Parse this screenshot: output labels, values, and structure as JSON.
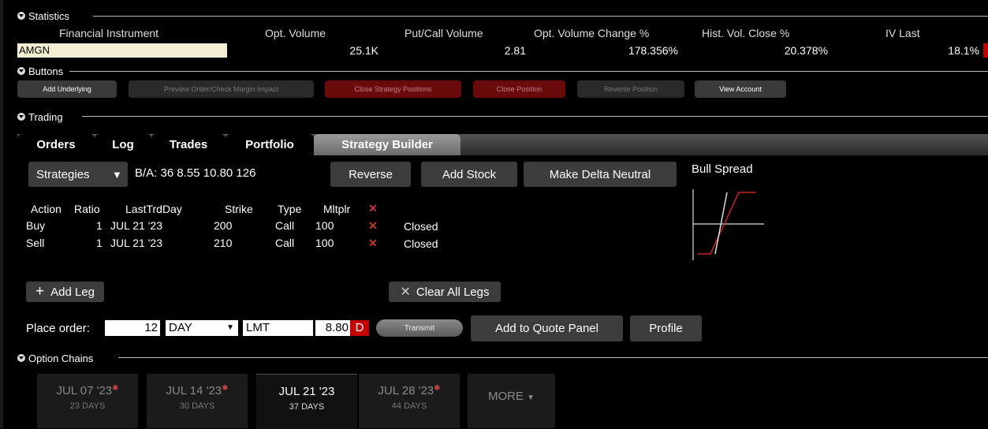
{
  "sections": {
    "statistics": "Statistics",
    "buttons": "Buttons",
    "trading": "Trading",
    "option_chains": "Option Chains"
  },
  "stats": {
    "headers": [
      "Financial Instrument",
      "Opt. Volume",
      "Put/Call Volume",
      "Opt. Volume Change %",
      "Hist. Vol. Close %",
      "IV Last"
    ],
    "instrument": "AMGN",
    "opt_volume": "25.1K",
    "put_call_volume": "2.81",
    "opt_volume_change": "178.356%",
    "hist_vol_close": "20.378%",
    "iv_last": "18.1%"
  },
  "buttons": {
    "add_underlying": "Add Underlying",
    "preview_order": "Preview Order/Check Margin Impact",
    "close_strategy": "Close Strategy Positions",
    "close_position": "Close Position",
    "reverse_position": "Reverse Position",
    "view_account": "View Account"
  },
  "tabs": [
    "Orders",
    "Log",
    "Trades",
    "Portfolio",
    "Strategy Builder"
  ],
  "strategy": {
    "strategies_label": "Strategies",
    "dropdown_arrow": "▼",
    "bid_ask": "B/A:  36  8.55  10.80  126",
    "reverse": "Reverse",
    "add_stock": "Add Stock",
    "make_delta_neutral": "Make Delta Neutral",
    "spread_name": "Bull Spread",
    "leg_headers": {
      "action": "Action",
      "ratio": "Ratio",
      "last_trd_day": "LastTrdDay",
      "strike": "Strike",
      "type": "Type",
      "mltplr": "Mltplr"
    },
    "legs": [
      {
        "action": "Buy",
        "ratio": "1",
        "last_trd_day": "JUL 21 '23",
        "strike": "200",
        "type": "Call",
        "mltplr": "100",
        "status": "Closed"
      },
      {
        "action": "Sell",
        "ratio": "1",
        "last_trd_day": "JUL 21 '23",
        "strike": "210",
        "type": "Call",
        "mltplr": "100",
        "status": "Closed"
      }
    ],
    "add_leg": "Add Leg",
    "clear_all_legs": "Clear All Legs"
  },
  "order": {
    "place_order_label": "Place order:",
    "quantity": "12",
    "tif": "DAY",
    "order_type": "LMT",
    "price": "8.80",
    "price_flag": "D",
    "transmit": "Transmit",
    "add_to_quote_panel": "Add to Quote Panel",
    "profile": "Profile"
  },
  "expirations": [
    {
      "date": "JUL 07 '23",
      "days": "23 DAYS",
      "starred": true,
      "active": false
    },
    {
      "date": "JUL 14 '23",
      "days": "30 DAYS",
      "starred": true,
      "active": false
    },
    {
      "date": "JUL 21 '23",
      "days": "37 DAYS",
      "starred": false,
      "active": true
    },
    {
      "date": "JUL 28 '23",
      "days": "44 DAYS",
      "starred": true,
      "active": false
    }
  ],
  "more_label": "MORE",
  "colors": {
    "accent_red": "#c40000",
    "instrument_bg": "#f3efd3",
    "payoff_red": "#cc2222"
  }
}
